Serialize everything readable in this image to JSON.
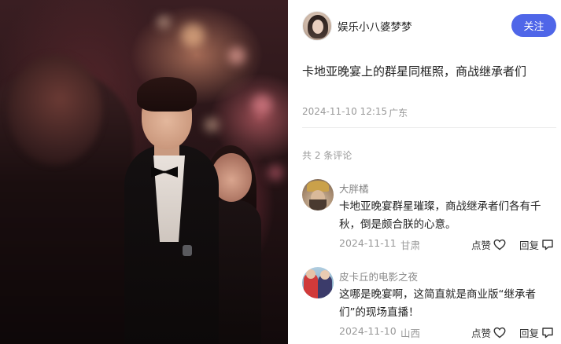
{
  "author": {
    "name": "娱乐小八婆梦梦",
    "follow_label": "关注"
  },
  "post": {
    "text": "卡地亚晚宴上的群星同框照，商战继承者们",
    "date": "2024-11-10 12:15",
    "location": "广东"
  },
  "comments_header": "共 2 条评论",
  "comments": [
    {
      "user": "大胖橘",
      "text": "卡地亚晚宴群星璀璨，商战继承者们各有千秋，倒是颇合朕的心意。",
      "date": "2024-11-11",
      "location": "甘肃",
      "like_label": "点赞",
      "reply_label": "回复"
    },
    {
      "user": "皮卡丘的电影之夜",
      "text": "这哪是晚宴啊，这简直就是商业版“继承者们”的现场直播！",
      "date": "2024-11-10",
      "location": "山西",
      "like_label": "点赞",
      "reply_label": "回复"
    }
  ],
  "colors": {
    "accent": "#4f66e8",
    "muted": "#999999",
    "text": "#222222"
  }
}
